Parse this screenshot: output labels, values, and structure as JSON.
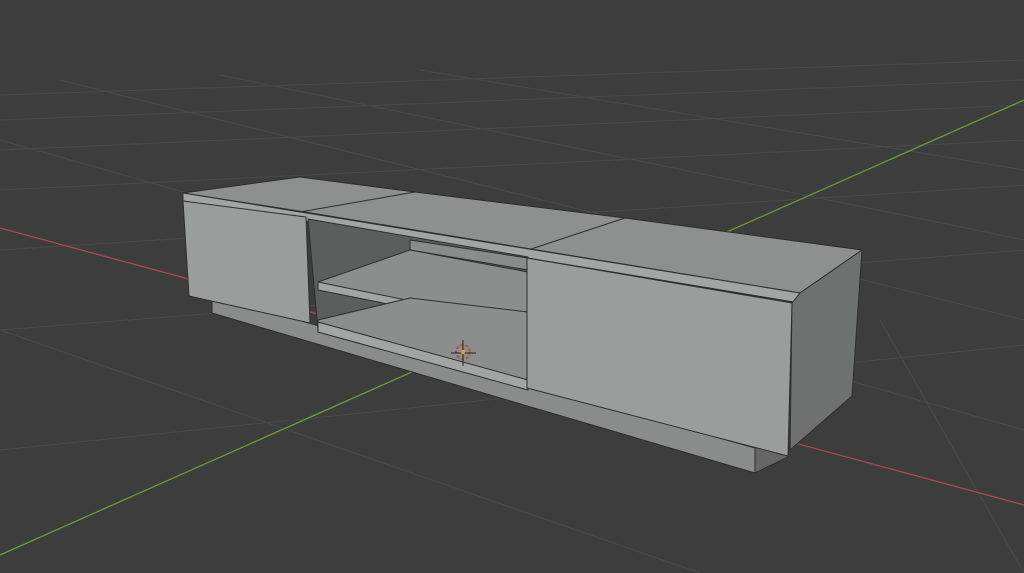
{
  "viewport": {
    "background": "#3d3d3d",
    "grid_color": "#4a4a4a",
    "x_axis_color": "#a84a52",
    "y_axis_color": "#6d9a3a"
  },
  "model": {
    "top_color": "#8e8f8f",
    "front_color": "#9b9c9c",
    "side_color": "#6f7070",
    "interior_color": "#5c5d5d",
    "edge_color": "#2e2e2e"
  },
  "cursor": {
    "ring_color": "#d04040",
    "center_color": "#e8a030"
  }
}
